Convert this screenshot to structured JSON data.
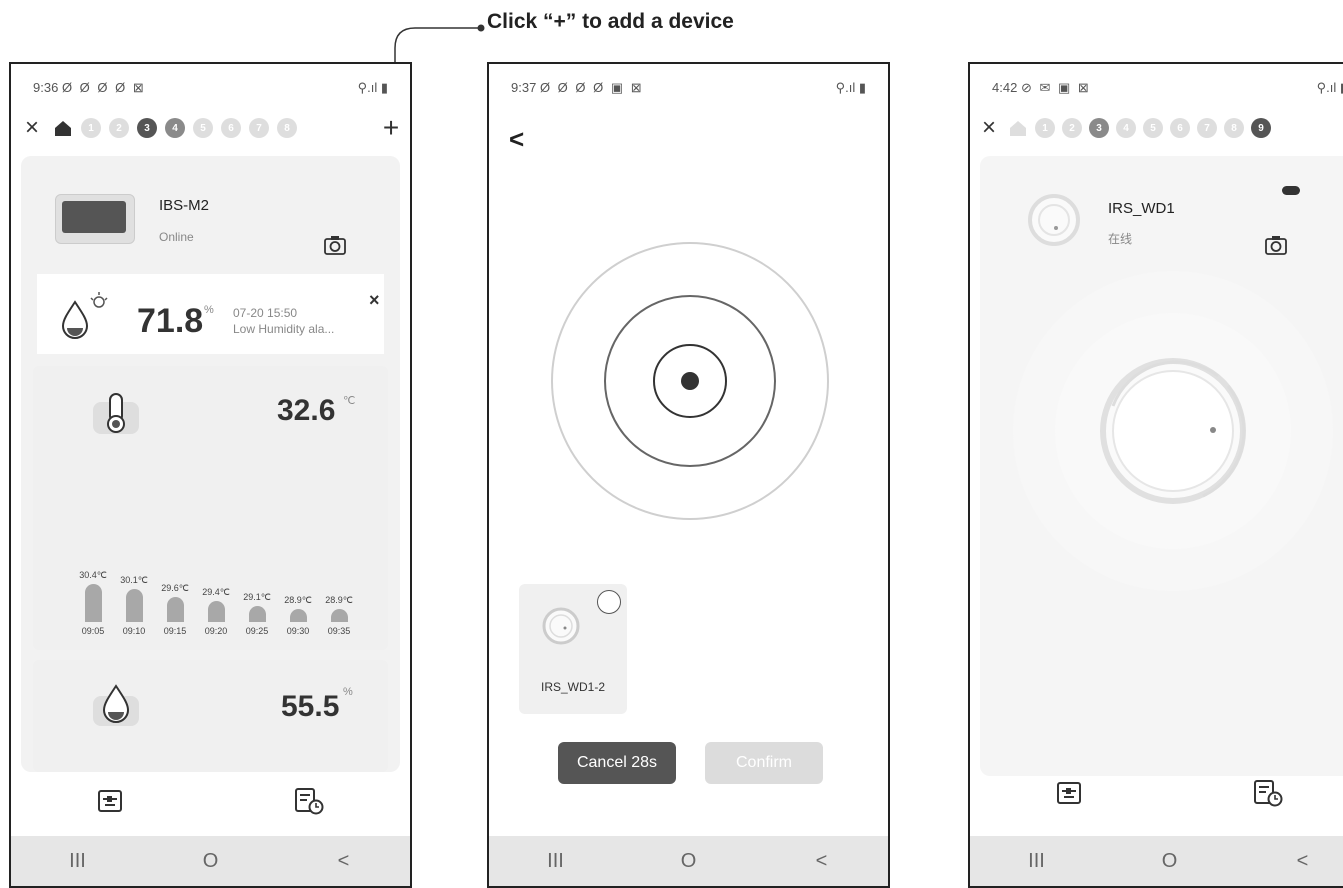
{
  "callout": {
    "text": "Click “+” to add a device"
  },
  "phone1": {
    "status_time": "9:36",
    "status_icons": "Ø Ø Ø Ø ⊠",
    "status_right": "⚲.ıl ▮",
    "close": "×",
    "add": "+",
    "dots": [
      "1",
      "2",
      "3",
      "4",
      "5",
      "6",
      "7",
      "8"
    ],
    "device_name": "IBS-M2",
    "device_status": "Online",
    "alarm_value": "71.8",
    "alarm_unit": "%",
    "alarm_time": "07-20 15:50",
    "alarm_text": "Low Humidity ala...",
    "alarm_close": "×",
    "temp_value": "32.6",
    "temp_unit": "℃",
    "humidity_value": "55.5",
    "humidity_unit": "%",
    "nav": [
      "III",
      "O",
      "<"
    ]
  },
  "chart_data": {
    "type": "bar",
    "categories": [
      "09:05",
      "09:10",
      "09:15",
      "09:20",
      "09:25",
      "09:30",
      "09:35"
    ],
    "labels": [
      "30.4℃",
      "30.1℃",
      "29.6℃",
      "29.4℃",
      "29.1℃",
      "28.9℃",
      "28.9℃"
    ],
    "values": [
      30.4,
      30.1,
      29.6,
      29.4,
      29.1,
      28.9,
      28.9
    ]
  },
  "phone2": {
    "status_time": "9:37",
    "status_icons": "Ø Ø Ø Ø ▣ ⊠",
    "status_right": "⚲.ıl ▮",
    "back": "<",
    "found_device": "IRS_WD1-2",
    "cancel_label": "Cancel  28s",
    "confirm_label": "Confirm",
    "nav": [
      "III",
      "O",
      "<"
    ]
  },
  "phone3": {
    "status_time": "4:42",
    "status_icons": "⊘ ✉ ▣ ⊠",
    "status_right": "⚲.ıl ▮",
    "close": "×",
    "add": "+",
    "dots": [
      "1",
      "2",
      "3",
      "4",
      "5",
      "6",
      "7",
      "8",
      "9"
    ],
    "device_name": "IRS_WD1",
    "device_status": "在线",
    "nav": [
      "III",
      "O",
      "<"
    ]
  }
}
